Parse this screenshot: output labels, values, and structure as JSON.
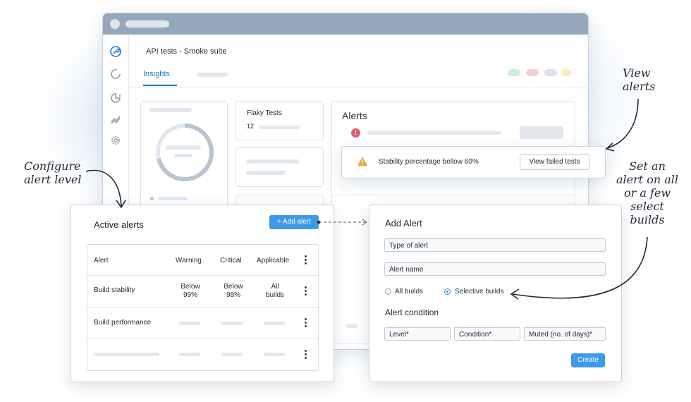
{
  "window": {
    "title": "API tests - Smoke suite",
    "tabs": [
      {
        "label": "Insights",
        "active": true
      }
    ]
  },
  "flaky": {
    "title": "Flaky Tests",
    "count": "12"
  },
  "alerts_panel": {
    "title": "Alerts",
    "toast": {
      "message": "Stability percentage bellow 60%",
      "button": "View failed tests"
    }
  },
  "active_alerts": {
    "title": "Active alerts",
    "add_button": "+ Add alert",
    "columns": [
      "Alert",
      "Warning",
      "Critical",
      "Applicable"
    ],
    "rows": [
      {
        "alert": "Build stability",
        "warning": "Below 99%",
        "critical": "Below 98%",
        "applicable": "All builds"
      },
      {
        "alert": "Build performance",
        "warning": "",
        "critical": "",
        "applicable": ""
      }
    ]
  },
  "add_alert": {
    "title": "Add Alert",
    "type_field": "Type of alert",
    "name_field": "Alert name",
    "radio_all": "All builds",
    "radio_selective": "Selective builds",
    "selected_radio": "Selective builds",
    "condition_title": "Alert condition",
    "level_field": "Level*",
    "condition_field": "Condition*",
    "muted_field": "Muted (no. of days)*",
    "create_button": "Create"
  },
  "annotations": {
    "view_alerts": [
      "View",
      "alerts"
    ],
    "configure": [
      "Configure",
      "alert level"
    ],
    "set_alert": [
      "Set an",
      "alert on all",
      "or a few",
      "select",
      "builds"
    ]
  },
  "colors": {
    "accent": "#3d9ae8",
    "tab_active": "#1e78c8",
    "error": "#e35d6a",
    "warning": "#f0a63a",
    "titlebar": "#95a7bb"
  }
}
